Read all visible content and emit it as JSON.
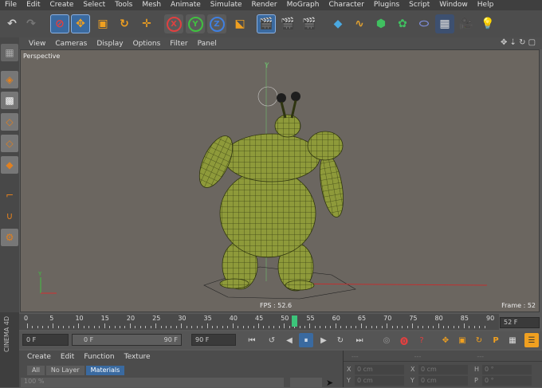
{
  "menubar": [
    "File",
    "Edit",
    "Create",
    "Select",
    "Tools",
    "Mesh",
    "Animate",
    "Simulate",
    "Render",
    "MoGraph",
    "Character",
    "Plugins",
    "Script",
    "Window",
    "Help"
  ],
  "toolbar": {
    "undo_icon": "undo-arrow",
    "mode_axes": [
      "X",
      "Y",
      "Z"
    ]
  },
  "viewport": {
    "menu": [
      "View",
      "Cameras",
      "Display",
      "Options",
      "Filter",
      "Panel"
    ],
    "label": "Perspective",
    "fps_text": "FPS : 52.6",
    "frame_text": "Frame : 52"
  },
  "timeline": {
    "ticks": [
      "0",
      "5",
      "10",
      "15",
      "20",
      "25",
      "30",
      "35",
      "40",
      "45",
      "50",
      "55",
      "60",
      "65",
      "70",
      "75",
      "80",
      "85",
      "90"
    ],
    "current": "52",
    "frame_field": "52 F"
  },
  "anim": {
    "start": "0 F",
    "range_start": "0 F",
    "range_end": "90 F",
    "end": "90 F"
  },
  "materials": {
    "menu": [
      "Create",
      "Edit",
      "Function",
      "Texture"
    ],
    "tabs": [
      "All",
      "No Layer",
      "Materials"
    ],
    "active_tab": "Materials",
    "zoom": "100 %"
  },
  "attributes": {
    "rows": [
      {
        "a_label": "X",
        "a_val": "0 cm",
        "b_label": "X",
        "b_val": "0 cm",
        "c_label": "H",
        "c_val": "0 °"
      },
      {
        "a_label": "Y",
        "a_val": "0 cm",
        "b_label": "Y",
        "b_val": "0 cm",
        "c_label": "P",
        "c_val": "0 °"
      }
    ]
  },
  "sidebar_label": "CINEMA 4D",
  "colors": {
    "accent_blue": "#3a6aa0",
    "viewport_bg": "#6b6660",
    "model_green": "#8e9a3a",
    "playhead": "#3cc47a"
  }
}
